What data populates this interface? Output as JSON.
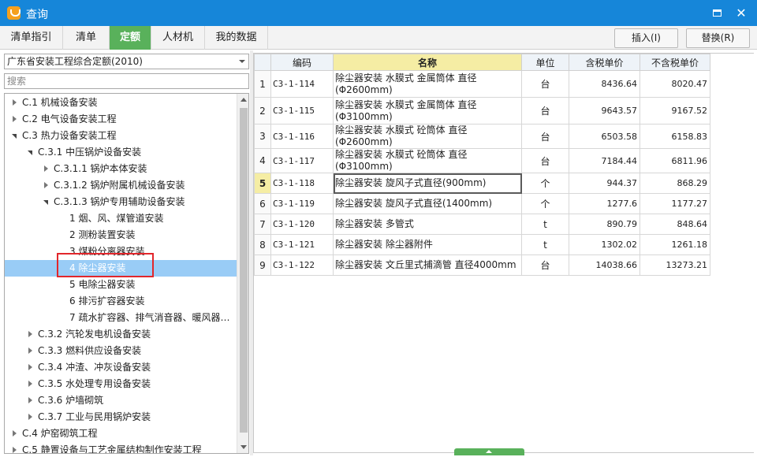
{
  "window": {
    "title": "查询"
  },
  "tabs": [
    {
      "label": "清单指引"
    },
    {
      "label": "清单"
    },
    {
      "label": "定额"
    },
    {
      "label": "人材机"
    },
    {
      "label": "我的数据"
    }
  ],
  "toolbar": {
    "insert_label": "插入(I)",
    "replace_label": "替换(R)"
  },
  "library": {
    "selected": "广东省安装工程综合定额(2010)"
  },
  "search": {
    "placeholder": "搜索",
    "value": ""
  },
  "tree": [
    {
      "label": "C.1 机械设备安装",
      "state": "collapsed"
    },
    {
      "label": "C.2 电气设备安装工程",
      "state": "collapsed"
    },
    {
      "label": "C.3 热力设备安装工程",
      "state": "expanded"
    },
    {
      "label": "C.3.1 中压锅炉设备安装",
      "state": "expanded"
    },
    {
      "label": "C.3.1.1 锅炉本体安装",
      "state": "collapsed"
    },
    {
      "label": "C.3.1.2 锅炉附属机械设备安装",
      "state": "collapsed"
    },
    {
      "label": "C.3.1.3 锅炉专用辅助设备安装",
      "state": "expanded"
    },
    {
      "label": "1 烟、风、煤管道安装",
      "state": "leaf"
    },
    {
      "label": "2 测粉装置安装",
      "state": "leaf"
    },
    {
      "label": "3 煤粉分离器安装",
      "state": "leaf"
    },
    {
      "label": "4 除尘器安装",
      "state": "leaf",
      "selected": true
    },
    {
      "label": "5 电除尘器安装",
      "state": "leaf"
    },
    {
      "label": "6 排污扩容器安装",
      "state": "leaf"
    },
    {
      "label": "7 疏水扩容器、排气消音器、暖风器…",
      "state": "leaf"
    },
    {
      "label": "C.3.2 汽轮发电机设备安装",
      "state": "collapsed"
    },
    {
      "label": "C.3.3 燃料供应设备安装",
      "state": "collapsed"
    },
    {
      "label": "C.3.4 冲渣、冲灰设备安装",
      "state": "collapsed"
    },
    {
      "label": "C.3.5 水处理专用设备安装",
      "state": "collapsed"
    },
    {
      "label": "C.3.6 炉墙砌筑",
      "state": "collapsed"
    },
    {
      "label": "C.3.7 工业与民用锅炉安装",
      "state": "collapsed"
    },
    {
      "label": "C.4 炉窑砌筑工程",
      "state": "collapsed"
    },
    {
      "label": "C.5 静置设备与工艺金属结构制作安装工程",
      "state": "collapsed"
    }
  ],
  "grid": {
    "columns": [
      "",
      "编码",
      "名称",
      "单位",
      "含税单价",
      "不含税单价"
    ],
    "current_row": 5,
    "rows": [
      {
        "idx": "1",
        "code": "C3-1-114",
        "name_line1": "除尘器安装 水膜式 金属筒体 直径",
        "name_line2": "(Φ2600mm)",
        "unit": "台",
        "price_tax": "8436.64",
        "price_notax": "8020.47"
      },
      {
        "idx": "2",
        "code": "C3-1-115",
        "name_line1": "除尘器安装 水膜式 金属筒体 直径",
        "name_line2": "(Φ3100mm)",
        "unit": "台",
        "price_tax": "9643.57",
        "price_notax": "9167.52"
      },
      {
        "idx": "3",
        "code": "C3-1-116",
        "name_line1": "除尘器安装 水膜式 砼筒体 直径(Φ2600mm)",
        "name_line2": "",
        "unit": "台",
        "price_tax": "6503.58",
        "price_notax": "6158.83"
      },
      {
        "idx": "4",
        "code": "C3-1-117",
        "name_line1": "除尘器安装 水膜式 砼筒体 直径(Φ3100mm)",
        "name_line2": "",
        "unit": "台",
        "price_tax": "7184.44",
        "price_notax": "6811.96"
      },
      {
        "idx": "5",
        "code": "C3-1-118",
        "name_line1": "除尘器安装 旋风子式直径(900mm)",
        "name_line2": "",
        "unit": "个",
        "price_tax": "944.37",
        "price_notax": "868.29"
      },
      {
        "idx": "6",
        "code": "C3-1-119",
        "name_line1": "除尘器安装 旋风子式直径(1400mm)",
        "name_line2": "",
        "unit": "个",
        "price_tax": "1277.6",
        "price_notax": "1177.27"
      },
      {
        "idx": "7",
        "code": "C3-1-120",
        "name_line1": "除尘器安装 多管式",
        "name_line2": "",
        "unit": "t",
        "price_tax": "890.79",
        "price_notax": "848.64"
      },
      {
        "idx": "8",
        "code": "C3-1-121",
        "name_line1": "除尘器安装 除尘器附件",
        "name_line2": "",
        "unit": "t",
        "price_tax": "1302.02",
        "price_notax": "1261.18"
      },
      {
        "idx": "9",
        "code": "C3-1-122",
        "name_line1": "除尘器安装 文丘里式捕滴管 直径4000mm",
        "name_line2": "",
        "unit": "台",
        "price_tax": "14038.66",
        "price_notax": "13273.21"
      }
    ]
  },
  "colors": {
    "titlebar": "#1686d9",
    "active_tab": "#59b15b",
    "selection": "#99ccf6",
    "header_highlight": "#f5eda4",
    "callout": "#e2262b"
  }
}
